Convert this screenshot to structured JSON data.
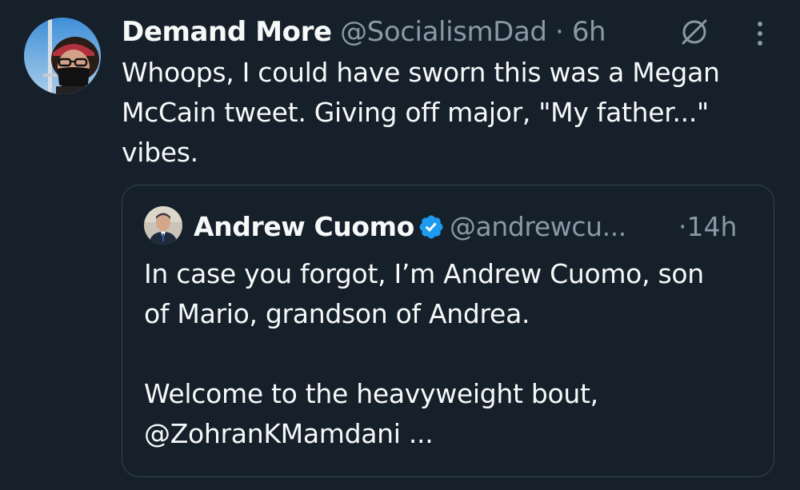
{
  "colors": {
    "background": "#15202b",
    "text_primary": "#f7f9f9",
    "text_secondary": "#8b98a5",
    "border": "#38444d",
    "verified_blue": "#1d9bf0"
  },
  "tweet": {
    "author_name": "Demand More",
    "author_handle": "@SocialismDad",
    "separator": "·",
    "time": "6h",
    "icons": [
      "avatar-photo",
      "grok-icon",
      "more-options-icon"
    ],
    "text": "Whoops, I could have sworn this was a Megan\nMcCain tweet. Giving off major, \"My father...\"\nvibes."
  },
  "quote": {
    "author_name": "Andrew Cuomo",
    "verified": true,
    "author_handle": "@andrewcu...",
    "separator": "·",
    "time": "14h",
    "lines": [
      "In case you forgot, I’m Andrew Cuomo, son",
      "of Mario, grandson of Andrea.",
      "",
      "Welcome to the heavyweight bout,",
      "@ZohranKMamdani ..."
    ]
  }
}
